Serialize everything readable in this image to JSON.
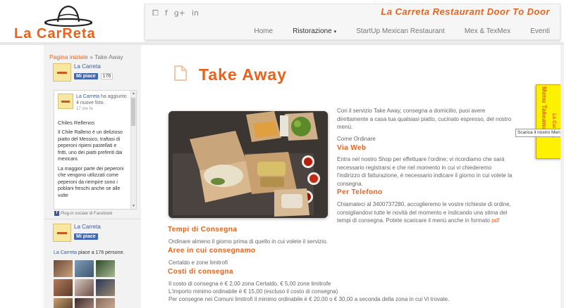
{
  "header": {
    "logo_text": "La CarReta",
    "tagline": "La Carreta Restaurant Door To Door",
    "social_icons": [
      "rss-icon",
      "facebook-icon",
      "google-plus-icon",
      "linkedin-icon"
    ],
    "social_glyphs": [
      "⧠",
      "f",
      "g+",
      "in"
    ],
    "nav": [
      {
        "label": "Home"
      },
      {
        "label": "Ristorazione",
        "caret": "▾"
      },
      {
        "label": "StartUp Mexican Restaurant"
      },
      {
        "label": "Mex & TexMex"
      },
      {
        "label": "Eventi"
      }
    ],
    "accent_color": "#e8621c"
  },
  "breadcrumb": {
    "home": "Pagina iniziale",
    "sep": " » ",
    "current": "Take Away"
  },
  "facebook": {
    "page_name": "La Carreta",
    "like_label": "Mi piace",
    "like_count": "176",
    "post": {
      "author": "La Carreta",
      "action": " ha aggiunto 4 nuove foto.",
      "time": "17 ore fa",
      "title": "Chiles Rellenos",
      "body1": "Il Chile Ralleno è un delizioso piatto del Messico, traftasi di peperoni ripieni pastellati e fritti, uno dei piatti preferiti dai mexicani.",
      "body2": "La maggior parte dei peperoni che vengono utilizzati come peperoni da riempire sono i poblani freschi anche se alle volte"
    },
    "plugin_text": "Plug-in sociale di Facebook",
    "likes_sentence_name": "La Carreta",
    "likes_sentence_rest": " piace a 176 persone."
  },
  "main": {
    "title": "Take Away",
    "intro": "Con il servizio Take Away, consegna a domicilio, puoi avere direttamente a casa tua qualsiasi piatto, cucinato espresso, del nostro menù.",
    "how_to_order": "Come Ordinare",
    "web_heading": "Via Web",
    "web_text": "Entra nel nostro Shop per effettuare l'ordine; vi ricordiamo che sarà necessario registrarsi e che nel momento in cui vi chiederemo l'indirizzo di fatturazione, è necessario indicare il giorno in cui volete la consegna.",
    "phone_heading": "Per Telefono",
    "phone_text": "Chiamateci al 3400737280, accoglieremo le vostre richieste di ordine, consigliandovi tutte le novità del momento e indicando una stima dei tempi di consegna. Potete scaricare il menù anche in formato ",
    "pdf_link": "pdf",
    "delivery_times_heading": "Tempi di Consegna",
    "delivery_times_text": "Ordinare almeno il giorno prima di quello in cui volete il servizio.",
    "areas_heading": "Aree in cui consegnamo",
    "areas_text": "Certaldo e zone limitrofi",
    "costs_heading": "Costi di consegna",
    "costs_line1": "Il costo di consegna è € 2,00 zona Certaldo, € 5,00 zone limitrofe",
    "costs_line2": "L'importo minimo ordinabile è € 15,00 (escluso il costo di consegna)",
    "costs_line3": "Per consegne nei Comuni limitrofi il minimo ordinabile è € 20,00 o € 30,00 a seconda della zona in cui Vi trovate."
  },
  "sidetab": {
    "label": "Menu Takeaway",
    "sublabel": "La Carreta",
    "tooltip": "Scarica il nostro Menu"
  }
}
